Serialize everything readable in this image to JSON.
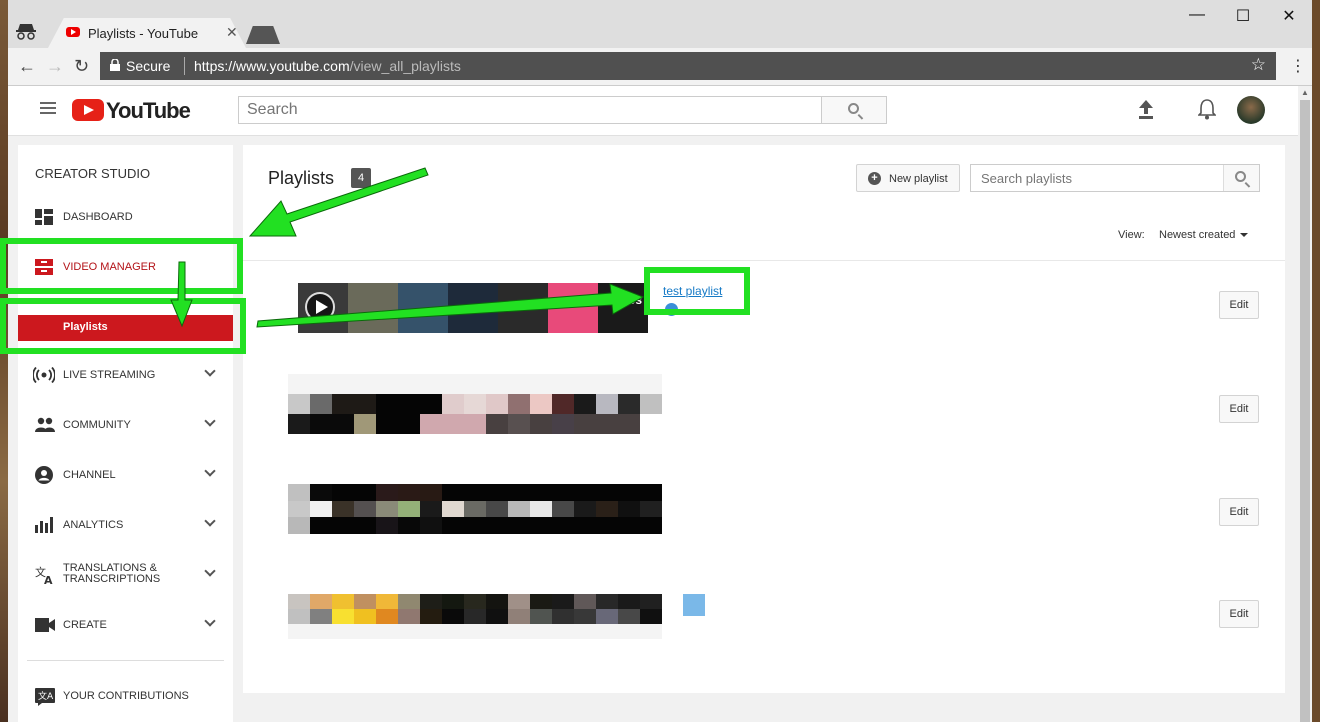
{
  "browser": {
    "tab_title": "Playlists - YouTube",
    "secure_label": "Secure",
    "url_host": "https://www.youtube.com",
    "url_path": "/view_all_playlists"
  },
  "masthead": {
    "logo_text": "YouTube",
    "search_placeholder": "Search"
  },
  "sidebar": {
    "title": "CREATOR STUDIO",
    "items": [
      {
        "label": "DASHBOARD",
        "icon": "dashboard-icon"
      },
      {
        "label": "VIDEO MANAGER",
        "icon": "video-manager-icon"
      },
      {
        "label": "Playlists"
      },
      {
        "label": "LIVE STREAMING",
        "icon": "live-streaming-icon"
      },
      {
        "label": "COMMUNITY",
        "icon": "community-icon"
      },
      {
        "label": "CHANNEL",
        "icon": "channel-icon"
      },
      {
        "label": "ANALYTICS",
        "icon": "analytics-icon"
      },
      {
        "label": "TRANSLATIONS & TRANSCRIPTIONS",
        "icon": "translate-icon"
      },
      {
        "label": "CREATE",
        "icon": "video-camera-icon"
      },
      {
        "label": "YOUR CONTRIBUTIONS",
        "icon": "contributions-icon"
      }
    ]
  },
  "main": {
    "title": "Playlists",
    "count": "4",
    "new_playlist_label": "New playlist",
    "search_placeholder": "Search playlists",
    "view_label": "View:",
    "view_value": "Newest created",
    "playlists": [
      {
        "title": "test playlist",
        "edit_label": "Edit",
        "thumb_overlay": "os"
      },
      {
        "edit_label": "Edit"
      },
      {
        "edit_label": "Edit"
      },
      {
        "edit_label": "Edit"
      }
    ]
  },
  "colors": {
    "youtube_red": "#e62117",
    "active_red": "#cc181e",
    "link_blue": "#167ac6",
    "annotation_green": "#22e022"
  }
}
